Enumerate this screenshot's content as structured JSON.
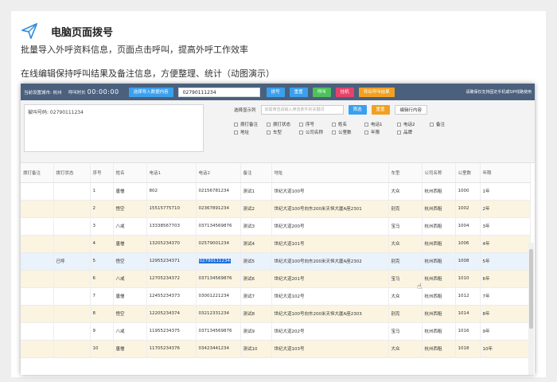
{
  "header": {
    "title": "电脑页面拨号",
    "line1": "批量导入外呼资料信息，页面点击呼叫，提高外呼工作效率",
    "line2": "在线编辑保持呼叫结果及备注信息，方便整理、统计（动图演示）"
  },
  "toolbar": {
    "city": "当前设置城市: 杭州",
    "timer_label": "呼叫时长",
    "timer": "00:00:00",
    "import_button": "选择导入数据内容",
    "phone_value": "02790111234",
    "buttons": [
      {
        "label": "拨号",
        "color": "#3aa0ee"
      },
      {
        "label": "重置",
        "color": "#3aa0ee"
      },
      {
        "label": "呼叫",
        "color": "#4dc15a"
      },
      {
        "label": "挂机",
        "color": "#e7426a"
      },
      {
        "label": "导出呼叫结果",
        "color": "#f1a022"
      }
    ],
    "right_text": "请确保仅支持固定手机或SIP线路使用"
  },
  "panel": {
    "note_text": "被叫号码: 02790111234",
    "display_label": "选择显示列",
    "search_placeholder": "如需筛选请输入筛选条件的关键词",
    "filter_button": "筛选",
    "reset_button": "重置",
    "edit_button": "编辑行内容",
    "checkboxes": [
      [
        "拨打备注",
        "拨打状态",
        "序号",
        "姓名",
        "电话1",
        "电话2",
        "备注"
      ],
      [
        "地址",
        "车型",
        "公司名称",
        "公里数",
        "年限",
        "品牌"
      ]
    ]
  },
  "table": {
    "headers": [
      "拨打备注",
      "拨打状态",
      "序号",
      "姓名",
      "电话1",
      "电话2",
      "备注",
      "地址",
      "车型",
      "公司名称",
      "公里数",
      "年限"
    ],
    "rows": [
      [
        "",
        "",
        "1",
        "唐僧",
        "802",
        "02156781234",
        "测试1",
        "世纪大道100号",
        "大众",
        "杭州西租",
        "1000",
        "1年"
      ],
      [
        "",
        "",
        "2",
        "悟空",
        "15515775710",
        "02367891234",
        "测试2",
        "世纪大道100号向东200米天恒大厦A座2301",
        "别克",
        "杭州西租",
        "1002",
        "2年"
      ],
      [
        "",
        "",
        "3",
        "八戒",
        "13338567703",
        "037134569876",
        "测试3",
        "世纪大道200号",
        "宝马",
        "杭州西租",
        "1004",
        "3年"
      ],
      [
        "",
        "",
        "4",
        "唐僧",
        "13205234370",
        "02579001234",
        "测试4",
        "世纪大道101号",
        "大众",
        "杭州西租",
        "1006",
        "4年"
      ],
      [
        "",
        "已呼",
        "5",
        "悟空",
        "12955234371",
        "02790111234",
        "测试5",
        "世纪大道100号向东200米天恒大厦A座2302",
        "别克",
        "杭州西租",
        "1008",
        "5年"
      ],
      [
        "",
        "",
        "6",
        "八戒",
        "12705234372",
        "037134569876",
        "测试6",
        "世纪大道201号",
        "宝马",
        "杭州西租",
        "1010",
        "6年"
      ],
      [
        "",
        "",
        "7",
        "唐僧",
        "12455234373",
        "03001221234",
        "测试7",
        "世纪大道102号",
        "大众",
        "杭州西租",
        "1012",
        "7年"
      ],
      [
        "",
        "",
        "8",
        "悟空",
        "12205234374",
        "03212331234",
        "测试8",
        "世纪大道100号向东200米天恒大厦A座2303",
        "别克",
        "杭州西租",
        "1014",
        "8年"
      ],
      [
        "",
        "",
        "9",
        "八戒",
        "11955234375",
        "037134569876",
        "测试9",
        "世纪大道202号",
        "宝马",
        "杭州西租",
        "1016",
        "9年"
      ],
      [
        "",
        "",
        "10",
        "唐僧",
        "11705234376",
        "03423441234",
        "测试10",
        "世纪大道103号",
        "大众",
        "杭州西租",
        "1018",
        "10年"
      ]
    ],
    "highlight_phone": "02790111234"
  }
}
